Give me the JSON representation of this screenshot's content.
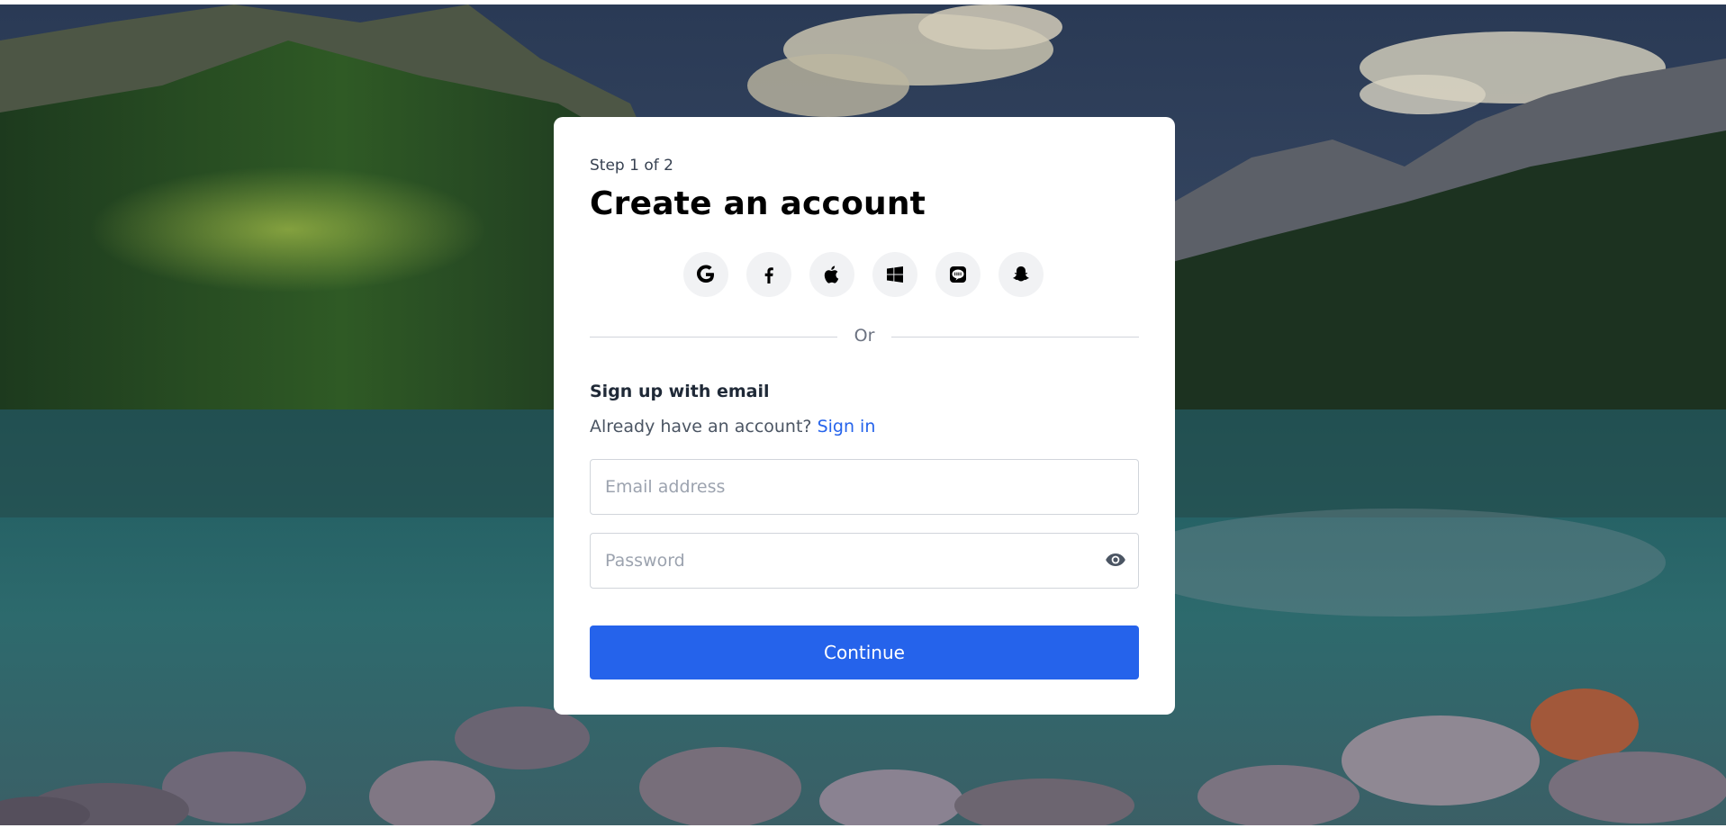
{
  "form": {
    "step_label": "Step 1 of 2",
    "title": "Create an account",
    "divider_text": "Or",
    "subheading": "Sign up with email",
    "have_account_text": "Already have an account?",
    "sign_in_link": "Sign in",
    "email_placeholder": "Email address",
    "password_placeholder": "Password",
    "continue_label": "Continue"
  },
  "social_providers": [
    "google-icon",
    "facebook-icon",
    "apple-icon",
    "windows-icon",
    "line-icon",
    "snapchat-icon"
  ],
  "colors": {
    "accent": "#2563eb",
    "card_bg": "#ffffff",
    "button_text": "#ffffff"
  }
}
